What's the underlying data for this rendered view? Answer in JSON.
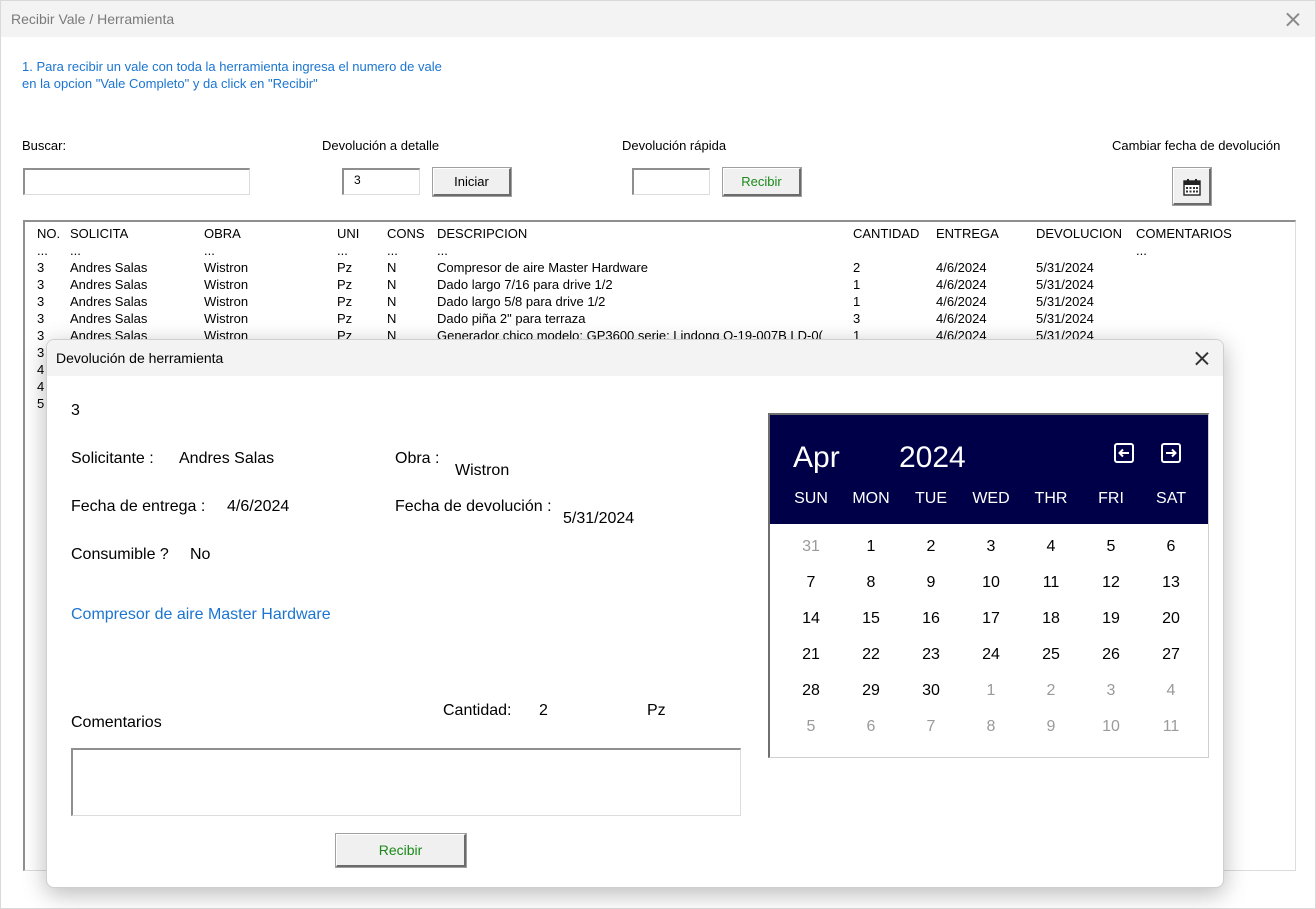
{
  "window": {
    "title": "Recibir Vale / Herramienta"
  },
  "instructions": {
    "line1": "1. Para recibir un vale con toda la herramienta ingresa el numero de vale",
    "line2": "en la opcion \"Vale Completo\" y da click en \"Recibir\""
  },
  "search": {
    "label": "Buscar:",
    "value": ""
  },
  "detail_return": {
    "label": "Devolución a detalle",
    "value": "3",
    "button": "Iniciar"
  },
  "quick_return": {
    "label": "Devolución rápida",
    "value": "",
    "button": "Recibir"
  },
  "change_date": {
    "label": "Cambiar fecha de devolución",
    "icon": "calendar-icon"
  },
  "list": {
    "headers": [
      "NO.",
      "SOLICITA",
      "OBRA",
      "UNI",
      "CONS",
      "DESCRIPCION",
      "CANTIDAD",
      "ENTREGA",
      "DEVOLUCION",
      "COMENTARIOS"
    ],
    "ellipsis_row": [
      "...",
      "...",
      "...",
      "...",
      "...",
      "...",
      "",
      "",
      "",
      "..."
    ],
    "rows": [
      [
        "3",
        "Andres Salas",
        "Wistron",
        "Pz",
        "N",
        "Compresor de aire Master Hardware",
        "2",
        "4/6/2024",
        "5/31/2024",
        ""
      ],
      [
        "3",
        "Andres Salas",
        "Wistron",
        "Pz",
        "N",
        "Dado largo 7/16 para drive 1/2",
        "1",
        "4/6/2024",
        "5/31/2024",
        ""
      ],
      [
        "3",
        "Andres Salas",
        "Wistron",
        "Pz",
        "N",
        "Dado largo 5/8 para drive 1/2",
        "1",
        "4/6/2024",
        "5/31/2024",
        ""
      ],
      [
        "3",
        "Andres Salas",
        "Wistron",
        "Pz",
        "N",
        "Dado piña 2\" para terraza",
        "3",
        "4/6/2024",
        "5/31/2024",
        ""
      ],
      [
        "3",
        "Andres Salas",
        "Wistron",
        "Pz",
        "N",
        "Generador chico modelo: GP3600 serie: Lindong Q-19-007B LD-0(",
        "1",
        "4/6/2024",
        "5/31/2024",
        ""
      ],
      [
        "3",
        "",
        "",
        "",
        "",
        "",
        "",
        "",
        "",
        ""
      ],
      [
        "4",
        "",
        "",
        "",
        "",
        "",
        "",
        "",
        "",
        ""
      ],
      [
        "4",
        "",
        "",
        "",
        "",
        "",
        "",
        "",
        "",
        ""
      ],
      [
        "5",
        "",
        "",
        "",
        "",
        "",
        "",
        "",
        "",
        ""
      ]
    ]
  },
  "dialog": {
    "title": "Devolución de herramienta",
    "vale_number": "3",
    "solicitante_label": "Solicitante :",
    "solicitante_value": "Andres Salas",
    "obra_label": "Obra :",
    "obra_value": "Wistron",
    "fecha_entrega_label": "Fecha de entrega :",
    "fecha_entrega_value": "4/6/2024",
    "fecha_devolucion_label": "Fecha de devolución :",
    "fecha_devolucion_value": "5/31/2024",
    "consumible_label": "Consumible ?",
    "consumible_value": "No",
    "tool_description": "Compresor de aire Master Hardware",
    "comentarios_label": "Comentarios",
    "comentarios_value": "",
    "cantidad_label": "Cantidad:",
    "cantidad_value": "2",
    "unidad_value": "Pz",
    "recibir_button": "Recibir"
  },
  "calendar": {
    "month": "Apr",
    "year": "2024",
    "prev_icon": "arrow-left-icon",
    "next_icon": "arrow-right-icon",
    "header_color": "#000048",
    "weekdays": [
      "SUN",
      "MON",
      "TUE",
      "WED",
      "THR",
      "FRI",
      "SAT"
    ],
    "weeks": [
      [
        "31",
        "1",
        "2",
        "3",
        "4",
        "5",
        "6"
      ],
      [
        "7",
        "8",
        "9",
        "10",
        "11",
        "12",
        "13"
      ],
      [
        "14",
        "15",
        "16",
        "17",
        "18",
        "19",
        "20"
      ],
      [
        "21",
        "22",
        "23",
        "24",
        "25",
        "26",
        "27"
      ],
      [
        "28",
        "29",
        "30",
        "1",
        "2",
        "3",
        "4"
      ],
      [
        "5",
        "6",
        "7",
        "8",
        "9",
        "10",
        "11"
      ]
    ],
    "in_month": [
      [
        false,
        true,
        true,
        true,
        true,
        true,
        true
      ],
      [
        true,
        true,
        true,
        true,
        true,
        true,
        true
      ],
      [
        true,
        true,
        true,
        true,
        true,
        true,
        true
      ],
      [
        true,
        true,
        true,
        true,
        true,
        true,
        true
      ],
      [
        true,
        true,
        true,
        false,
        false,
        false,
        false
      ],
      [
        false,
        false,
        false,
        false,
        false,
        false,
        false
      ]
    ]
  },
  "colors": {
    "instruction_blue": "#1b75d0",
    "button_green": "#1a8a1a",
    "calendar_navy": "#000048"
  }
}
